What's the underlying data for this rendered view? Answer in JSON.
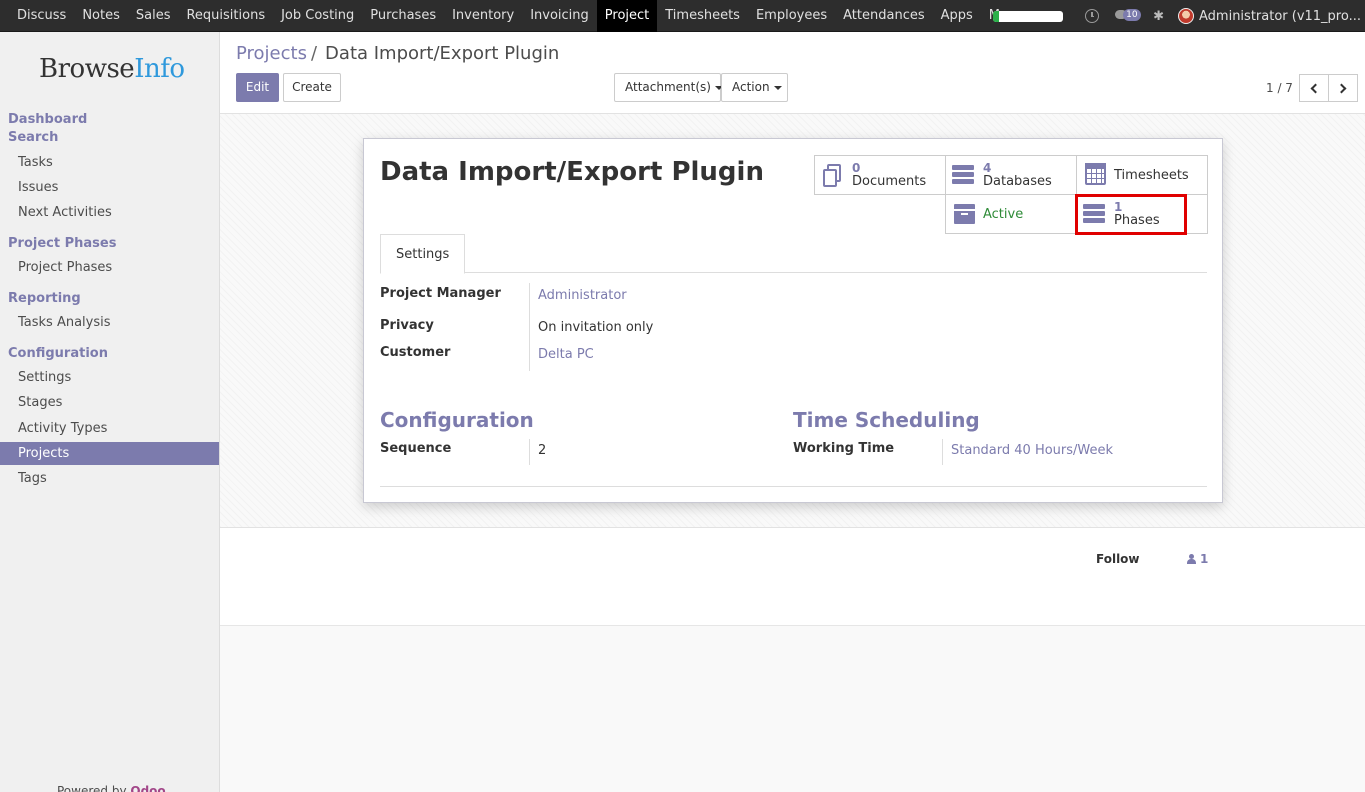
{
  "topbar": {
    "menu": [
      "Discuss",
      "Notes",
      "Sales",
      "Requisitions",
      "Job Costing",
      "Purchases",
      "Inventory",
      "Invoicing",
      "Project",
      "Timesheets",
      "Employees",
      "Attendances",
      "Apps",
      "More"
    ],
    "active_index": 8,
    "progress_fraction": 0.08,
    "chat_badge": "10",
    "user": "Administrator (v11_pro..."
  },
  "sidebar": {
    "logo_part1": "Browse",
    "logo_part2": "Info",
    "sections": {
      "dashboard": "Dashboard",
      "search": "Search",
      "project_phases": "Project Phases",
      "reporting": "Reporting",
      "configuration": "Configuration"
    },
    "items": {
      "tasks": "Tasks",
      "issues": "Issues",
      "next_activities": "Next Activities",
      "project_phases": "Project Phases",
      "tasks_analysis": "Tasks Analysis",
      "settings": "Settings",
      "stages": "Stages",
      "activity_types": "Activity Types",
      "projects": "Projects",
      "tags": "Tags"
    },
    "powered_by": "Powered by",
    "powered_brand": "Odoo"
  },
  "control": {
    "breadcrumb_parent": "Projects",
    "breadcrumb_sep": "/",
    "breadcrumb_current": "Data Import/Export Plugin",
    "edit_label": "Edit",
    "create_label": "Create",
    "attachments_label": "Attachment(s)",
    "action_label": "Action",
    "pager": "1 / 7"
  },
  "form": {
    "title": "Data Import/Export Plugin",
    "stats": {
      "documents_count": "0",
      "documents_label": "Documents",
      "databases_count": "4",
      "databases_label": "Databases",
      "timesheets_label": "Timesheets",
      "active_label": "Active",
      "phases_count": "1",
      "phases_label": "Phases"
    },
    "tab_settings": "Settings",
    "fields": {
      "project_manager_label": "Project Manager",
      "project_manager_value": "Administrator",
      "privacy_label": "Privacy",
      "privacy_value": "On invitation only",
      "customer_label": "Customer",
      "customer_value": "Delta PC"
    },
    "configuration": {
      "title": "Configuration",
      "sequence_label": "Sequence",
      "sequence_value": "2"
    },
    "time_scheduling": {
      "title": "Time Scheduling",
      "working_time_label": "Working Time",
      "working_time_value": "Standard 40 Hours/Week"
    }
  },
  "chatter": {
    "follow_label": "Follow",
    "followers_count": "1"
  },
  "colors": {
    "accent": "#7c7bad",
    "topbar": "#2d2d2d",
    "highlight": "#e00000",
    "active_green": "#2e8b37"
  }
}
